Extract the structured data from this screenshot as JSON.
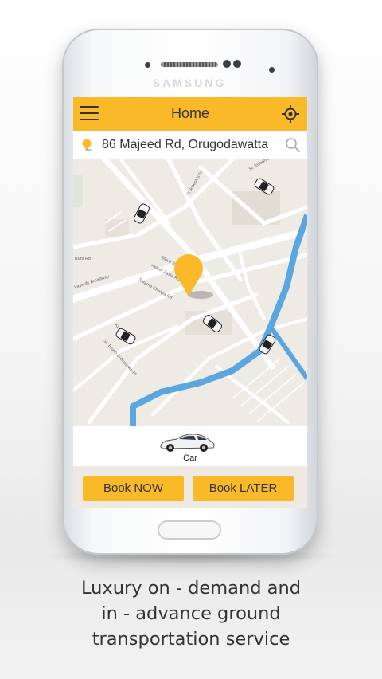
{
  "device": {
    "brand": "SAMSUNG"
  },
  "app_bar": {
    "title": "Home",
    "menu_icon": "hamburger-menu-icon",
    "locate_icon": "crosshair-locate-icon",
    "color": "#f9b928"
  },
  "address": {
    "text": "86 Majeed Rd, Orugodawatta",
    "pin_icon": "map-pin-icon",
    "search_icon": "search-icon"
  },
  "map": {
    "street_labels": [
      "St Joseph's Pl",
      "St Joseph's St",
      "Steve Rd",
      "Aweer Zavia Rd",
      "Swarna Chaitya Rd",
      "Layards Broadway",
      "Kimmathe",
      "Sir Bruno Buthabuwe Pl",
      "Burs Rd"
    ]
  },
  "vehicle": {
    "label": "Car"
  },
  "buttons": {
    "book_now": "Book NOW",
    "book_later": "Book LATER"
  },
  "tagline": [
    "Luxury on - demand and",
    "in - advance ground",
    "transportation service"
  ]
}
